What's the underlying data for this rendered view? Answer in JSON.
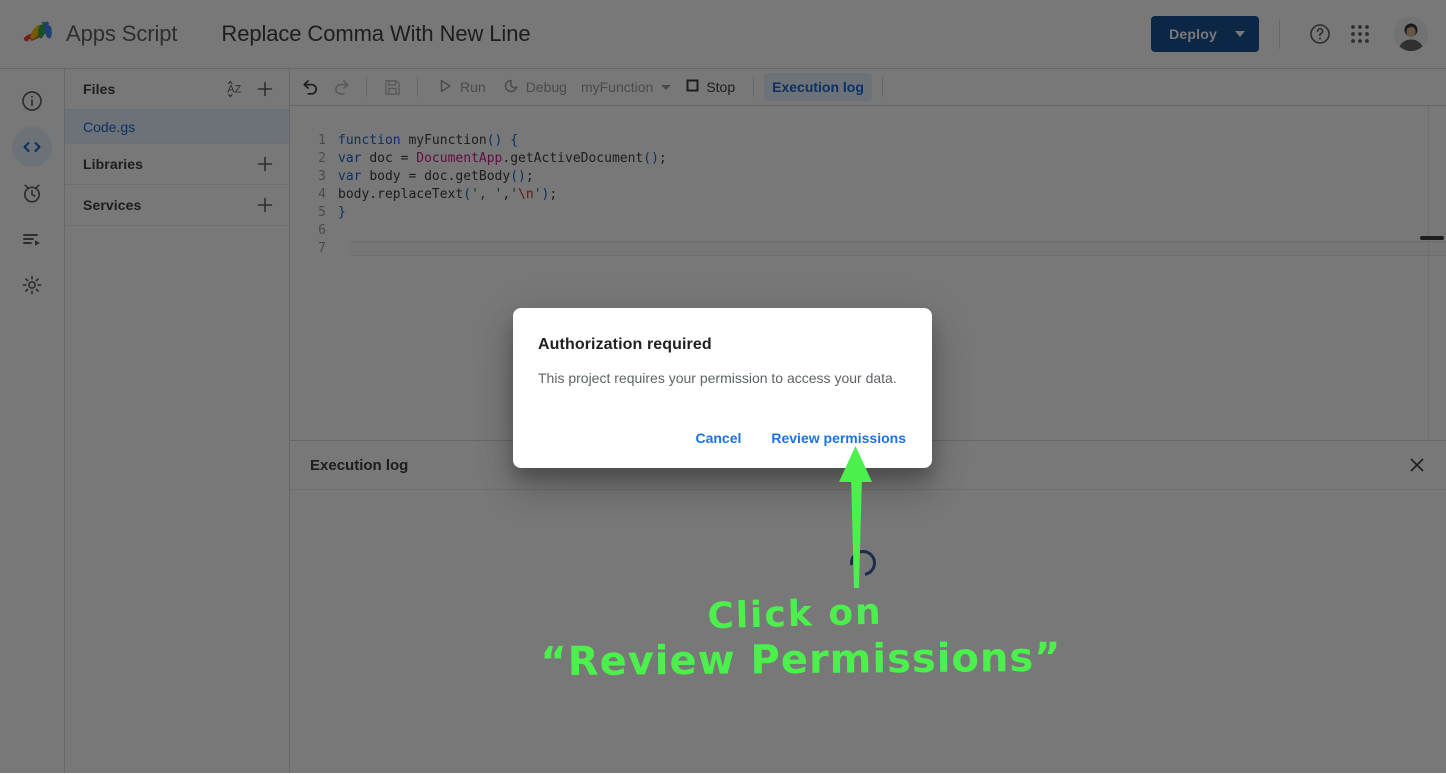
{
  "header": {
    "brand_name": "Apps Script",
    "project_title": "Replace Comma With New Line",
    "deploy_label": "Deploy",
    "logo_icon": "apps-script-logo",
    "help_icon": "help-circle-icon",
    "apps_icon": "apps-grid-icon",
    "avatar_icon": "user-avatar",
    "deploy_color": "#1a5296"
  },
  "rail": {
    "items": [
      {
        "icon": "info-circle-icon",
        "label": "Overview",
        "active": false
      },
      {
        "icon": "code-brackets-icon",
        "label": "Editor",
        "active": true
      },
      {
        "icon": "alarm-clock-icon",
        "label": "Triggers",
        "active": false
      },
      {
        "icon": "executions-list-icon",
        "label": "Executions",
        "active": false
      },
      {
        "icon": "gear-icon",
        "label": "Project Settings",
        "active": false
      }
    ],
    "active_color": "#1967d2"
  },
  "files_panel": {
    "sections": [
      {
        "title": "Files",
        "sort_icon": "sort-az-icon",
        "add_icon": "plus-icon"
      },
      {
        "title": "Libraries",
        "add_icon": "plus-icon"
      },
      {
        "title": "Services",
        "add_icon": "plus-icon"
      }
    ],
    "files": [
      {
        "name": "Code.gs",
        "selected": true
      }
    ]
  },
  "toolbar": {
    "undo_icon": "undo-arrow-icon",
    "redo_icon": "redo-arrow-icon",
    "save_icon": "save-disk-icon",
    "run_label": "Run",
    "run_icon": "play-triangle-icon",
    "debug_label": "Debug",
    "debug_icon": "debug-bug-icon",
    "function_selected": "myFunction",
    "function_caret_icon": "chevron-down-icon",
    "stop_label": "Stop",
    "stop_icon": "stop-square-icon",
    "execution_log_label": "Execution log"
  },
  "editor": {
    "language": "javascript",
    "lines": [
      {
        "n": "1",
        "tokens": [
          {
            "t": "function ",
            "c": "k"
          },
          {
            "t": "myFunction",
            "c": "ct"
          },
          {
            "t": "()",
            "c": "p"
          },
          {
            "t": " ",
            "c": "ct"
          },
          {
            "t": "{",
            "c": "p"
          }
        ]
      },
      {
        "n": "2",
        "tokens": [
          {
            "t": "var ",
            "c": "k"
          },
          {
            "t": "doc = ",
            "c": "ct"
          },
          {
            "t": "DocumentApp",
            "c": "cls"
          },
          {
            "t": ".getActiveDocument",
            "c": "ct"
          },
          {
            "t": "()",
            "c": "p"
          },
          {
            "t": ";",
            "c": "ct"
          }
        ]
      },
      {
        "n": "3",
        "tokens": [
          {
            "t": "var ",
            "c": "k"
          },
          {
            "t": "body = doc.getBody",
            "c": "ct"
          },
          {
            "t": "()",
            "c": "p"
          },
          {
            "t": ";",
            "c": "ct"
          }
        ]
      },
      {
        "n": "4",
        "tokens": [
          {
            "t": "body.replaceText",
            "c": "ct"
          },
          {
            "t": "(",
            "c": "p"
          },
          {
            "t": "', '",
            "c": "s"
          },
          {
            "t": ",",
            "c": "ct"
          },
          {
            "t": "'",
            "c": "s"
          },
          {
            "t": "\\n",
            "c": "esc"
          },
          {
            "t": "'",
            "c": "s"
          },
          {
            "t": ")",
            "c": "p"
          },
          {
            "t": ";",
            "c": "ct"
          }
        ]
      },
      {
        "n": "5",
        "tokens": [
          {
            "t": "}",
            "c": "p"
          }
        ]
      },
      {
        "n": "6",
        "tokens": []
      },
      {
        "n": "7",
        "tokens": []
      }
    ]
  },
  "execution_log": {
    "title": "Execution log",
    "close_icon": "close-x-icon",
    "status": "loading",
    "spinner_icon": "loading-spinner-icon"
  },
  "dialog": {
    "title": "Authorization required",
    "body": "This project requires your permission to access your data.",
    "cancel_label": "Cancel",
    "confirm_label": "Review permissions",
    "link_color": "#1a73e8"
  },
  "annotation": {
    "line1": "Click on",
    "line2": "“Review Permissions”",
    "arrow_icon": "up-arrow-annotation",
    "color": "#4cf04c"
  }
}
